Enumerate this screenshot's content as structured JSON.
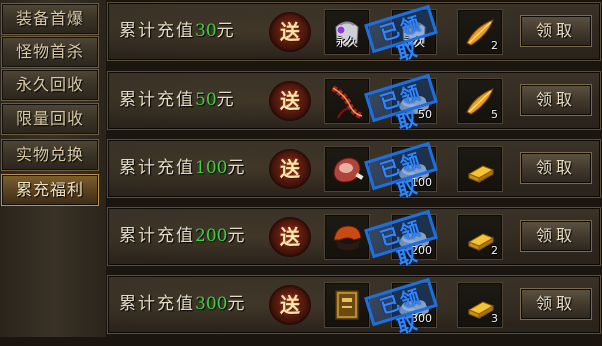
{
  "sidebar": {
    "items": [
      {
        "label": "装备首爆",
        "active": false
      },
      {
        "label": "怪物首杀",
        "active": false
      },
      {
        "label": "永久回收",
        "active": false
      },
      {
        "label": "限量回收",
        "active": false
      },
      {
        "label": "实物兑换",
        "active": false
      },
      {
        "label": "累充福利",
        "active": true
      }
    ]
  },
  "rows": [
    {
      "label_prefix": "累计充值",
      "amount": "30",
      "label_suffix": "元",
      "gift_label": "送",
      "items": [
        {
          "icon": "bag-icon",
          "overlay": "永久",
          "qty": ""
        },
        {
          "icon": "bag-icon",
          "overlay": "永久",
          "qty": ""
        },
        {
          "icon": "golden-feather-icon",
          "overlay": "",
          "qty": "2"
        }
      ],
      "claimed_stamp": "已领取",
      "claim_label": "领取"
    },
    {
      "label_prefix": "累计充值",
      "amount": "50",
      "label_suffix": "元",
      "gift_label": "送",
      "items": [
        {
          "icon": "red-rope-icon",
          "overlay": "",
          "qty": ""
        },
        {
          "icon": "silver-pile-icon",
          "overlay": "",
          "qty": "50"
        },
        {
          "icon": "golden-feather-icon",
          "overlay": "",
          "qty": "5"
        }
      ],
      "claimed_stamp": "已领取",
      "claim_label": "领取"
    },
    {
      "label_prefix": "累计充值",
      "amount": "100",
      "label_suffix": "元",
      "gift_label": "送",
      "items": [
        {
          "icon": "meat-icon",
          "overlay": "",
          "qty": ""
        },
        {
          "icon": "silver-pile-icon",
          "overlay": "",
          "qty": "100"
        },
        {
          "icon": "gold-bar-icon",
          "overlay": "",
          "qty": ""
        }
      ],
      "claimed_stamp": "已领取",
      "claim_label": "领取"
    },
    {
      "label_prefix": "累计充值",
      "amount": "200",
      "label_suffix": "元",
      "gift_label": "送",
      "items": [
        {
          "icon": "helmet-icon",
          "overlay": "",
          "qty": ""
        },
        {
          "icon": "silver-pile-icon",
          "overlay": "",
          "qty": "200"
        },
        {
          "icon": "gold-bar-icon",
          "overlay": "",
          "qty": "2"
        }
      ],
      "claimed_stamp": "已领取",
      "claim_label": "领取"
    },
    {
      "label_prefix": "累计充值",
      "amount": "300",
      "label_suffix": "元",
      "gift_label": "送",
      "items": [
        {
          "icon": "book-icon",
          "overlay": "",
          "qty": ""
        },
        {
          "icon": "silver-pile-icon",
          "overlay": "",
          "qty": "300"
        },
        {
          "icon": "gold-bar-icon",
          "overlay": "",
          "qty": "3"
        }
      ],
      "claimed_stamp": "已领取",
      "claim_label": "领取"
    }
  ],
  "colors": {
    "amount": "#3fd23f",
    "stamp": "#1d6fe0",
    "gift": "#7a2b18"
  }
}
